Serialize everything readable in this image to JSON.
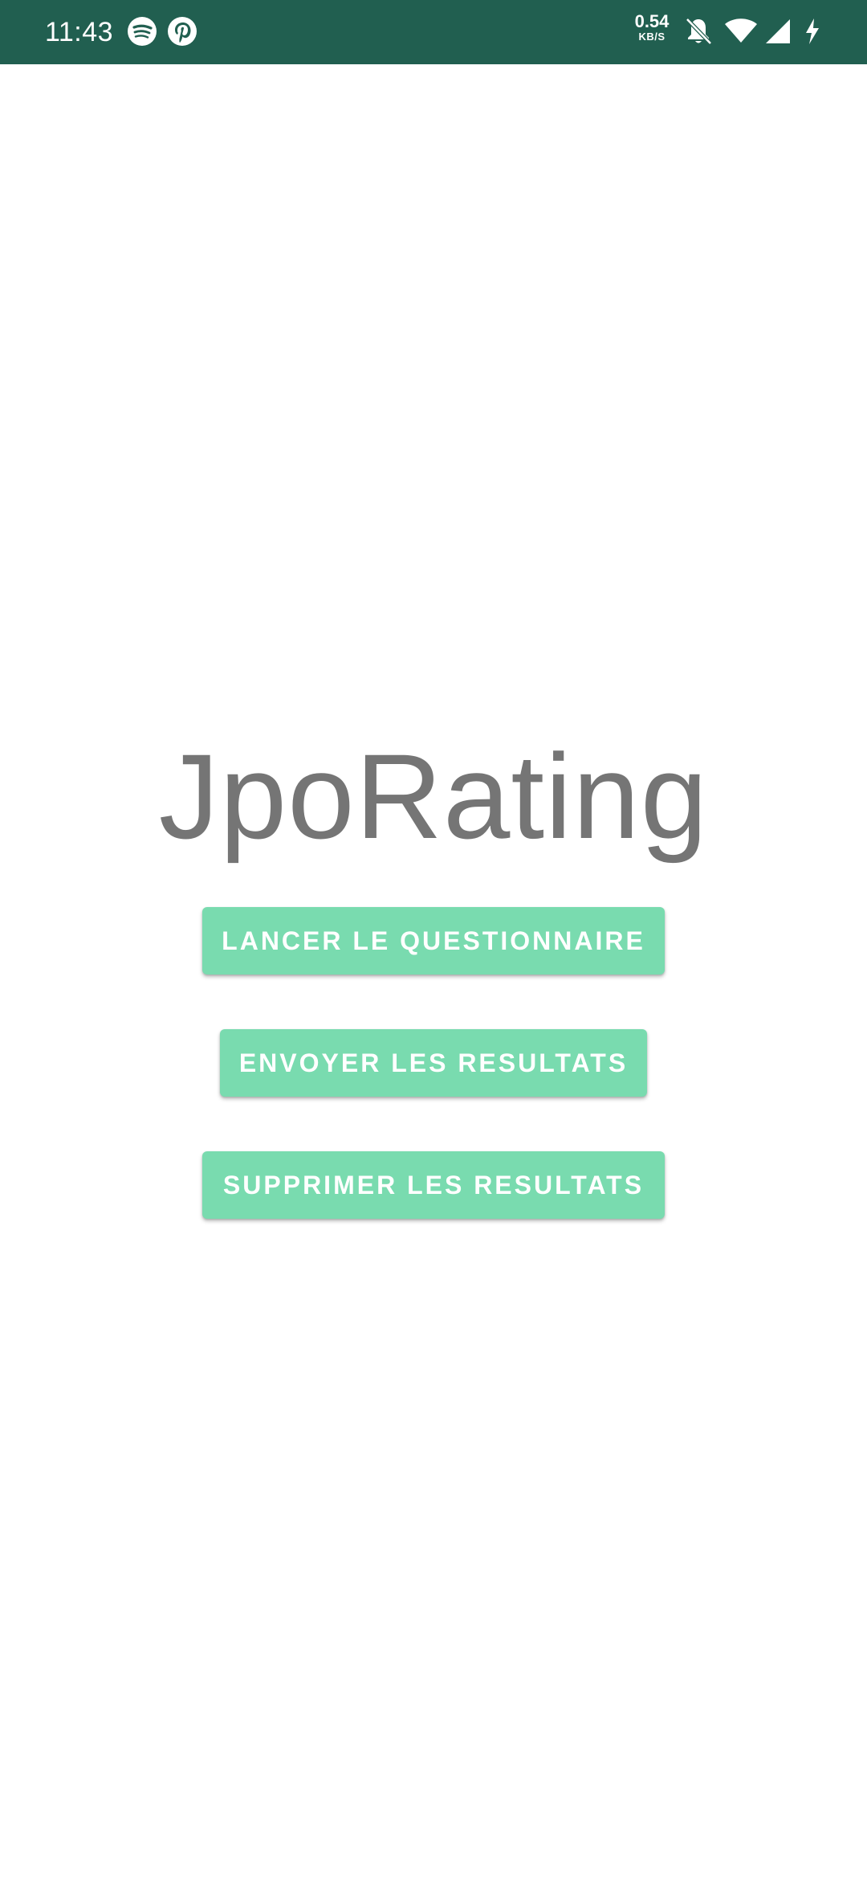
{
  "status_bar": {
    "time": "11:43",
    "net_speed_value": "0.54",
    "net_speed_unit": "KB/S",
    "icons": [
      "spotify-icon",
      "pinterest-icon",
      "bell-off-icon",
      "wifi-icon",
      "cell-signal-icon",
      "charging-icon"
    ],
    "background_color": "#215f50"
  },
  "main": {
    "title": "JpoRating",
    "buttons": {
      "launch": "LANCER LE QUESTIONNAIRE",
      "send": "ENVOYER LES RESULTATS",
      "delete": "SUPPRIMER LES RESULTATS"
    },
    "button_color": "#79dbaf",
    "title_color": "#757575"
  }
}
